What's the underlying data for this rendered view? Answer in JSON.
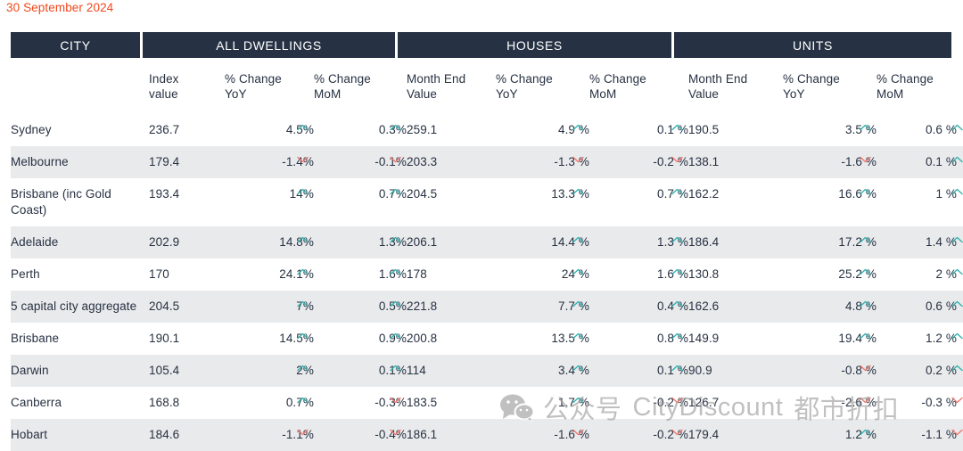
{
  "report": {
    "date_label": "30 September 2024"
  },
  "colors": {
    "header_bg": "#263244",
    "date_text": "#f0481b",
    "stripe": "#e9eaec",
    "up_arrow": "#2fb3ae",
    "down_arrow": "#f2766b",
    "text": "#273142"
  },
  "groups": [
    {
      "key": "city",
      "label": "CITY"
    },
    {
      "key": "all_dwellings",
      "label": "ALL DWELLINGS"
    },
    {
      "key": "houses",
      "label": "HOUSES"
    },
    {
      "key": "units",
      "label": "UNITS"
    }
  ],
  "subheaders": [
    {
      "line1": "",
      "line2": ""
    },
    {
      "line1": "Index",
      "line2": "value"
    },
    {
      "line1": "% Change",
      "line2": "YoY"
    },
    {
      "line1": "% Change",
      "line2": "MoM"
    },
    {
      "line1": "Month End",
      "line2": "Value"
    },
    {
      "line1": "% Change",
      "line2": "YoY"
    },
    {
      "line1": "% Change",
      "line2": "MoM"
    },
    {
      "line1": "Month End",
      "line2": "Value"
    },
    {
      "line1": "% Change",
      "line2": "YoY"
    },
    {
      "line1": "% Change",
      "line2": "MoM"
    }
  ],
  "rows": [
    {
      "city": "Sydney",
      "all_index": "236.7",
      "all_yoy": "4.5%",
      "all_yoy_dir": "up",
      "all_mom": "0.3%",
      "all_mom_dir": "up",
      "houses_value": "259.1",
      "houses_yoy": "4.9 %",
      "houses_yoy_dir": "up",
      "houses_mom": "0.1 %",
      "houses_mom_dir": "up",
      "units_value": "190.5",
      "units_yoy": "3.5 %",
      "units_yoy_dir": "up",
      "units_mom": "0.6 %",
      "units_mom_dir": "up"
    },
    {
      "city": "Melbourne",
      "all_index": "179.4",
      "all_yoy": "-1.4%",
      "all_yoy_dir": "down",
      "all_mom": "-0.1%",
      "all_mom_dir": "down",
      "houses_value": "203.3",
      "houses_yoy": "-1.3 %",
      "houses_yoy_dir": "down",
      "houses_mom": "-0.2 %",
      "houses_mom_dir": "down",
      "units_value": "138.1",
      "units_yoy": "-1.6 %",
      "units_yoy_dir": "down",
      "units_mom": "0.1 %",
      "units_mom_dir": "up"
    },
    {
      "city": "Brisbane (inc Gold Coast)",
      "all_index": "193.4",
      "all_yoy": "14%",
      "all_yoy_dir": "up",
      "all_mom": "0.7%",
      "all_mom_dir": "up",
      "houses_value": "204.5",
      "houses_yoy": "13.3 %",
      "houses_yoy_dir": "up",
      "houses_mom": "0.7 %",
      "houses_mom_dir": "up",
      "units_value": "162.2",
      "units_yoy": "16.6 %",
      "units_yoy_dir": "up",
      "units_mom": "1 %",
      "units_mom_dir": "up"
    },
    {
      "city": "Adelaide",
      "all_index": "202.9",
      "all_yoy": "14.8%",
      "all_yoy_dir": "up",
      "all_mom": "1.3%",
      "all_mom_dir": "up",
      "houses_value": "206.1",
      "houses_yoy": "14.4 %",
      "houses_yoy_dir": "up",
      "houses_mom": "1.3 %",
      "houses_mom_dir": "up",
      "units_value": "186.4",
      "units_yoy": "17.2 %",
      "units_yoy_dir": "up",
      "units_mom": "1.4 %",
      "units_mom_dir": "up"
    },
    {
      "city": "Perth",
      "all_index": "170",
      "all_yoy": "24.1%",
      "all_yoy_dir": "up",
      "all_mom": "1.6%",
      "all_mom_dir": "up",
      "houses_value": "178",
      "houses_yoy": "24 %",
      "houses_yoy_dir": "up",
      "houses_mom": "1.6 %",
      "houses_mom_dir": "up",
      "units_value": "130.8",
      "units_yoy": "25.2 %",
      "units_yoy_dir": "up",
      "units_mom": "2 %",
      "units_mom_dir": "up"
    },
    {
      "city": "5 capital city aggregate",
      "all_index": "204.5",
      "all_yoy": "7%",
      "all_yoy_dir": "up",
      "all_mom": "0.5%",
      "all_mom_dir": "up",
      "houses_value": "221.8",
      "houses_yoy": "7.7 %",
      "houses_yoy_dir": "up",
      "houses_mom": "0.4 %",
      "houses_mom_dir": "up",
      "units_value": "162.6",
      "units_yoy": "4.8 %",
      "units_yoy_dir": "up",
      "units_mom": "0.6 %",
      "units_mom_dir": "up"
    },
    {
      "city": "Brisbane",
      "all_index": "190.1",
      "all_yoy": "14.5%",
      "all_yoy_dir": "up",
      "all_mom": "0.9%",
      "all_mom_dir": "up",
      "houses_value": "200.8",
      "houses_yoy": "13.5 %",
      "houses_yoy_dir": "up",
      "houses_mom": "0.8 %",
      "houses_mom_dir": "up",
      "units_value": "149.9",
      "units_yoy": "19.4 %",
      "units_yoy_dir": "up",
      "units_mom": "1.2 %",
      "units_mom_dir": "up"
    },
    {
      "city": "Darwin",
      "all_index": "105.4",
      "all_yoy": "2%",
      "all_yoy_dir": "up",
      "all_mom": "0.1%",
      "all_mom_dir": "up",
      "houses_value": "114",
      "houses_yoy": "3.4 %",
      "houses_yoy_dir": "up",
      "houses_mom": "0.1 %",
      "houses_mom_dir": "up",
      "units_value": "90.9",
      "units_yoy": "-0.8 %",
      "units_yoy_dir": "down",
      "units_mom": "0.2 %",
      "units_mom_dir": "up"
    },
    {
      "city": "Canberra",
      "all_index": "168.8",
      "all_yoy": "0.7%",
      "all_yoy_dir": "up",
      "all_mom": "-0.3%",
      "all_mom_dir": "down",
      "houses_value": "183.5",
      "houses_yoy": "1.7 %",
      "houses_yoy_dir": "up",
      "houses_mom": "-0.2 %",
      "houses_mom_dir": "down",
      "units_value": "126.7",
      "units_yoy": "-2.6 %",
      "units_yoy_dir": "down",
      "units_mom": "-0.3 %",
      "units_mom_dir": "down"
    },
    {
      "city": "Hobart",
      "all_index": "184.6",
      "all_yoy": "-1.1%",
      "all_yoy_dir": "down",
      "all_mom": "-0.4%",
      "all_mom_dir": "down",
      "houses_value": "186.1",
      "houses_yoy": "-1.6 %",
      "houses_yoy_dir": "down",
      "houses_mom": "-0.2 %",
      "houses_mom_dir": "down",
      "units_value": "179.4",
      "units_yoy": "1.2 %",
      "units_yoy_dir": "up",
      "units_mom": "-1.1 %",
      "units_mom_dir": "down"
    }
  ],
  "watermark": {
    "chinese_prefix": "公众号",
    "brand": "CityDiscount",
    "chinese_suffix": "都市折扣"
  }
}
